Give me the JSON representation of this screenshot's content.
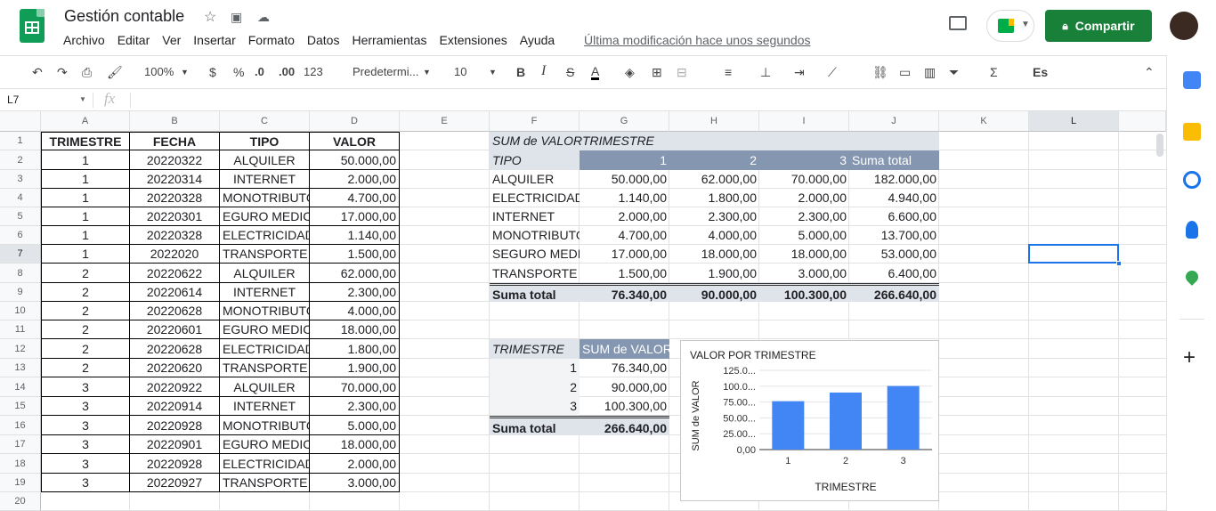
{
  "app": {
    "title": "Gestión contable",
    "last_modified": "Última modificación hace unos segundos",
    "share_label": "Compartir"
  },
  "menu": [
    "Archivo",
    "Editar",
    "Ver",
    "Insertar",
    "Formato",
    "Datos",
    "Herramientas",
    "Extensiones",
    "Ayuda"
  ],
  "toolbar": {
    "zoom": "100%",
    "currency": "$",
    "percent": "%",
    "dec_less": ".0",
    "dec_more": ".00",
    "format": "123",
    "font": "Predetermi...",
    "size": "10",
    "bold": "B",
    "italic": "I",
    "strike": "S",
    "text_color": "A",
    "input_lang": "Es"
  },
  "formula_bar": {
    "cell_ref": "L7",
    "fx": "fx",
    "value": ""
  },
  "columns": [
    "A",
    "B",
    "C",
    "D",
    "E",
    "F",
    "G",
    "H",
    "I",
    "J",
    "K",
    "L"
  ],
  "rows": [
    "1",
    "2",
    "3",
    "4",
    "5",
    "6",
    "7",
    "8",
    "9",
    "10",
    "11",
    "12",
    "13",
    "14",
    "15",
    "16",
    "17",
    "18",
    "19",
    "20"
  ],
  "table": {
    "headers": [
      "TRIMESTRE",
      "FECHA",
      "TIPO",
      "VALOR"
    ],
    "rows": [
      [
        "1",
        "20220322",
        "ALQUILER",
        "50.000,00"
      ],
      [
        "1",
        "20220314",
        "INTERNET",
        "2.000,00"
      ],
      [
        "1",
        "20220328",
        "MONOTRIBUTO",
        "4.700,00"
      ],
      [
        "1",
        "20220301",
        "EGURO MEDICO",
        "17.000,00"
      ],
      [
        "1",
        "20220328",
        "ELECTRICIDAD",
        "1.140,00"
      ],
      [
        "1",
        "2022020",
        "TRANSPORTE",
        "1.500,00"
      ],
      [
        "2",
        "20220622",
        "ALQUILER",
        "62.000,00"
      ],
      [
        "2",
        "20220614",
        "INTERNET",
        "2.300,00"
      ],
      [
        "2",
        "20220628",
        "MONOTRIBUTO",
        "4.000,00"
      ],
      [
        "2",
        "20220601",
        "EGURO MEDICO",
        "18.000,00"
      ],
      [
        "2",
        "20220628",
        "ELECTRICIDAD",
        "1.800,00"
      ],
      [
        "2",
        "20220620",
        "TRANSPORTE",
        "1.900,00"
      ],
      [
        "3",
        "20220922",
        "ALQUILER",
        "70.000,00"
      ],
      [
        "3",
        "20220914",
        "INTERNET",
        "2.300,00"
      ],
      [
        "3",
        "20220928",
        "MONOTRIBUTO",
        "5.000,00"
      ],
      [
        "3",
        "20220901",
        "EGURO MEDICO",
        "18.000,00"
      ],
      [
        "3",
        "20220928",
        "ELECTRICIDAD",
        "2.000,00"
      ],
      [
        "3",
        "20220927",
        "TRANSPORTE",
        "3.000,00"
      ]
    ]
  },
  "pivot1": {
    "corner": "SUM de VALOR",
    "col_field": "TRIMESTRE",
    "row_field": "TIPO",
    "col_headers": [
      "1",
      "2",
      "3",
      "Suma total"
    ],
    "rows": [
      [
        "ALQUILER",
        "50.000,00",
        "62.000,00",
        "70.000,00",
        "182.000,00"
      ],
      [
        "ELECTRICIDAD",
        "1.140,00",
        "1.800,00",
        "2.000,00",
        "4.940,00"
      ],
      [
        "INTERNET",
        "2.000,00",
        "2.300,00",
        "2.300,00",
        "6.600,00"
      ],
      [
        "MONOTRIBUTO",
        "4.700,00",
        "4.000,00",
        "5.000,00",
        "13.700,00"
      ],
      [
        "SEGURO MEDICO",
        "17.000,00",
        "18.000,00",
        "18.000,00",
        "53.000,00"
      ],
      [
        "TRANSPORTE",
        "1.500,00",
        "1.900,00",
        "3.000,00",
        "6.400,00"
      ]
    ],
    "total": [
      "Suma total",
      "76.340,00",
      "90.000,00",
      "100.300,00",
      "266.640,00"
    ]
  },
  "pivot2": {
    "headers": [
      "TRIMESTRE",
      "SUM de VALOR"
    ],
    "rows": [
      [
        "1",
        "76.340,00"
      ],
      [
        "2",
        "90.000,00"
      ],
      [
        "3",
        "100.300,00"
      ]
    ],
    "total": [
      "Suma total",
      "266.640,00"
    ]
  },
  "chart_data": {
    "type": "bar",
    "title": "VALOR POR TRIMESTRE",
    "xlabel": "TRIMESTRE",
    "ylabel": "SUM de VALOR",
    "categories": [
      "1",
      "2",
      "3"
    ],
    "values": [
      76340,
      90000,
      100300
    ],
    "ylim": [
      0,
      125000
    ],
    "ytick_labels": [
      "125.0...",
      "100.0...",
      "75.00...",
      "50.00...",
      "25.00...",
      "0,00"
    ],
    "bar_color": "#4285f4",
    "grid": true
  },
  "colors": {
    "pivot_header": "#8496b0",
    "pivot_header_light": "#dfe3ea",
    "accent": "#188038",
    "select": "#1a73e8"
  }
}
